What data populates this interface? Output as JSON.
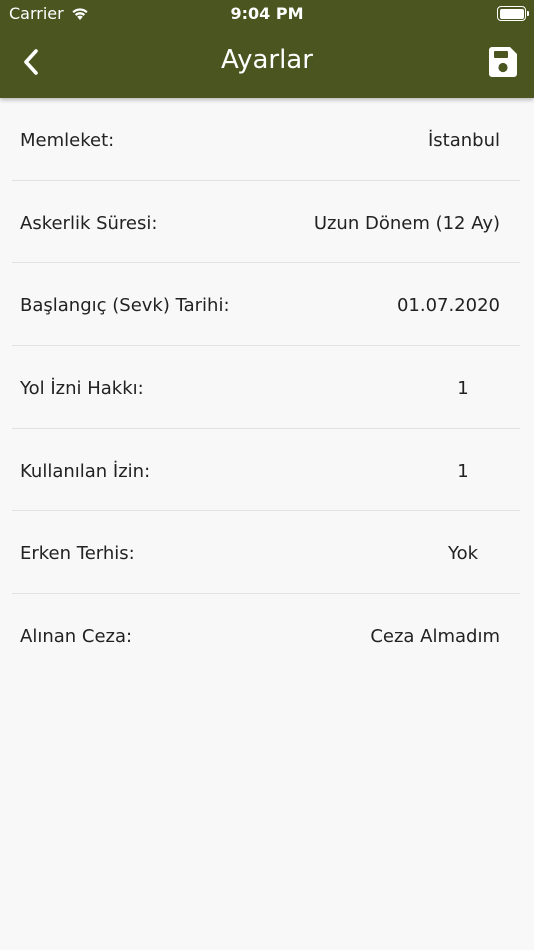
{
  "status_bar": {
    "carrier": "Carrier",
    "time": "9:04 PM"
  },
  "nav": {
    "title": "Ayarlar",
    "back_icon": "chevron-left-icon",
    "save_icon": "floppy-disk-icon",
    "bar_color": "#4a5520"
  },
  "settings": [
    {
      "label": "Memleket:",
      "value": "İstanbul",
      "align": "right"
    },
    {
      "label": "Askerlik Süresi:",
      "value": "Uzun Dönem (12 Ay)",
      "align": "right"
    },
    {
      "label": "Başlangıç (Sevk) Tarihi:",
      "value": "01.07.2020",
      "align": "right"
    },
    {
      "label": "Yol İzni Hakkı:",
      "value": "1",
      "align": "center"
    },
    {
      "label": "Kullanılan İzin:",
      "value": "1",
      "align": "center"
    },
    {
      "label": "Erken Terhis:",
      "value": "Yok",
      "align": "center"
    },
    {
      "label": "Alınan Ceza:",
      "value": "Ceza Almadım",
      "align": "right"
    }
  ]
}
